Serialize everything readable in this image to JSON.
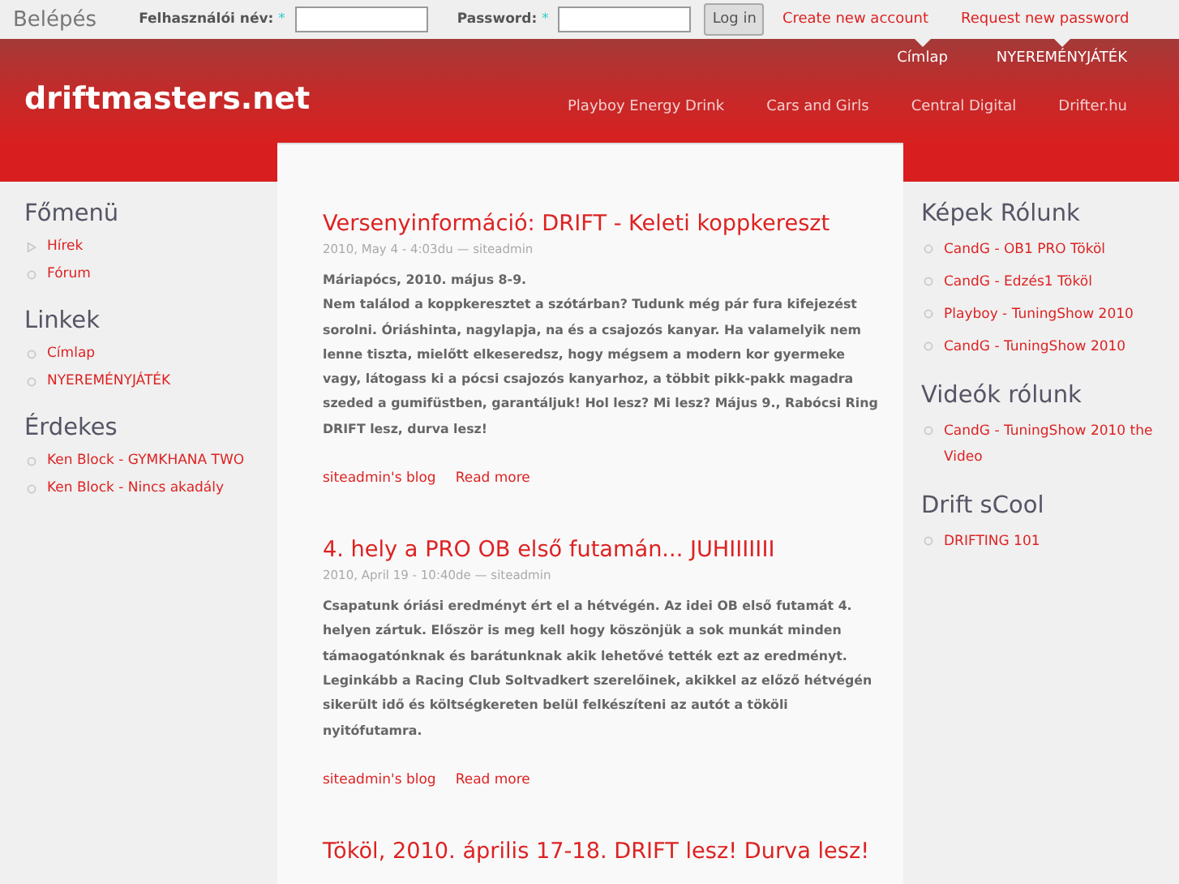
{
  "login": {
    "title": "Belépés",
    "fields": [
      {
        "label": "Felhasználói név:",
        "required_mark": "*"
      },
      {
        "label": "Password:",
        "required_mark": "*"
      }
    ],
    "button": "Log in",
    "links": [
      "Create new account",
      "Request new password"
    ]
  },
  "header": {
    "site_name": "driftmasters.net",
    "primary_links": [
      "Címlap",
      "NYEREMÉNYJÁTÉK"
    ],
    "secondary_links": [
      "Playboy Energy Drink",
      "Cars and Girls",
      "Central Digital",
      "Drifter.hu"
    ]
  },
  "left_sidebar": [
    {
      "title": "Főmenü",
      "items": [
        {
          "label": "Hírek",
          "kind": "collapsed"
        },
        {
          "label": "Fórum",
          "kind": "leaf"
        }
      ]
    },
    {
      "title": "Linkek",
      "items": [
        {
          "label": "Címlap",
          "kind": "leaf"
        },
        {
          "label": "NYEREMÉNYJÁTÉK",
          "kind": "leaf"
        }
      ]
    },
    {
      "title": "Érdekes",
      "items": [
        {
          "label": "Ken Block - GYMKHANA TWO",
          "kind": "leaf"
        },
        {
          "label": "Ken Block - Nincs akadály",
          "kind": "leaf"
        }
      ]
    }
  ],
  "posts": [
    {
      "title": "Versenyinformáció: DRIFT - Keleti koppkereszt",
      "meta": "2010, May 4 - 4:03du — siteadmin",
      "paragraphs": [
        "Máriapócs, 2010. május 8-9.",
        "Nem találod a koppkeresztet a szótárban? Tudunk még pár fura kifejezést sorolni. Óriáshinta, nagylapja, na és a csajozós kanyar. Ha valamelyik nem lenne tiszta, mielőtt elkeseredsz, hogy mégsem a modern kor gyermeke vagy, látogass ki a pócsi csajozós kanyarhoz, a többit pikk-pakk magadra szeded a gumifüstben, garantáljuk! Hol lesz? Mi lesz? Május 9., Rabócsi Ring DRIFT lesz, durva lesz!"
      ],
      "links": [
        "siteadmin's blog",
        "Read more"
      ]
    },
    {
      "title": "4. hely a PRO OB első futamán... JUHIIIIIII",
      "meta": "2010, April 19 - 10:40de — siteadmin",
      "paragraphs": [
        "Csapatunk óriási eredményt ért el a hétvégén. Az idei OB első futamát 4. helyen zártuk. Először is meg kell hogy köszönjük a sok munkát minden támaogatónknak és barátunknak akik lehetővé tették ezt az eredményt. Leginkább a Racing Club Soltvadkert szerelőinek, akikkel az előző hétvégén sikerült idő és költségkereten belül felkészíteni az autót a tököli nyitófutamra."
      ],
      "links": [
        "siteadmin's blog",
        "Read more"
      ]
    },
    {
      "title": "Tököl, 2010. április 17-18. DRIFT lesz! Durva lesz!"
    }
  ],
  "right_sidebar": [
    {
      "title": "Képek Rólunk",
      "items": [
        {
          "label": "CandG - OB1 PRO Tököl",
          "kind": "leaf"
        },
        {
          "label": "CandG - Edzés1 Tököl",
          "kind": "leaf"
        },
        {
          "label": "Playboy - TuningShow 2010",
          "kind": "leaf"
        },
        {
          "label": "CandG - TuningShow 2010",
          "kind": "leaf"
        }
      ]
    },
    {
      "title": "Videók rólunk",
      "items": [
        {
          "label": "CandG - TuningShow 2010 the Video",
          "kind": "leaf"
        }
      ]
    },
    {
      "title": "Drift sCool",
      "items": [
        {
          "label": "DRIFTING 101",
          "kind": "leaf"
        }
      ]
    }
  ]
}
